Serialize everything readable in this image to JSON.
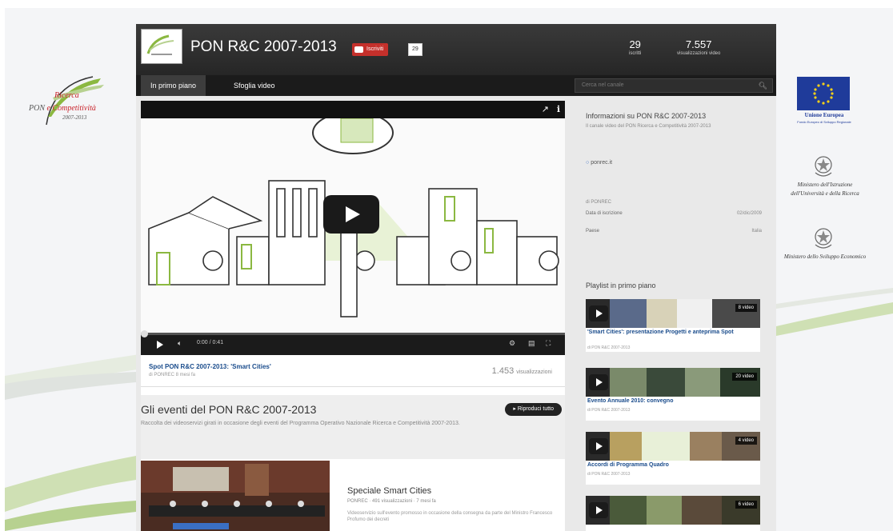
{
  "logo_left": {
    "line1": "Ricerca",
    "line2_prefix": "PON",
    "line2": "e Competitività",
    "line3": "2007-2013"
  },
  "logos_right": {
    "eu_title": "Unione Europea",
    "eu_subtitle": "Fondo Europeo di Sviluppo Regionale",
    "ministry1": "Ministero dell'Istruzione dell'Università e della Ricerca",
    "ministry2": "Ministero dello Sviluppo Economico"
  },
  "channel": {
    "title": "PON R&C 2007-2013",
    "subscribe_label": "Iscriviti",
    "subscribe_count": "29",
    "stats": [
      {
        "number": "29",
        "label": "iscritti"
      },
      {
        "number": "7.557",
        "label": "visualizzazioni video"
      }
    ]
  },
  "nav": {
    "tabs": [
      {
        "label": "In primo piano",
        "active": true
      },
      {
        "label": "Sfoglia video",
        "active": false
      }
    ],
    "search_placeholder": "Cerca nel canale"
  },
  "featured_video": {
    "time": "0:00 / 0:41",
    "title": "Spot PON R&C 2007-2013: 'Smart Cities'",
    "byline": "di PONREC 8 mesi fa",
    "views": "1.453",
    "views_label": "visualizzazioni"
  },
  "events": {
    "heading": "Gli eventi del PON R&C 2007-2013",
    "description": "Raccolta dei videoservizi girati in occasione degli eventi del Programma Operativo Nazionale Ricerca e Competitività 2007-2013.",
    "play_all": "Riproduci tutto"
  },
  "feature_item": {
    "title": "Speciale Smart Cities",
    "meta": "PONREC · 491 visualizzazioni · 7 mesi fa",
    "description": "Videoservizio sull'evento promosso in occasione della consegna da parte del Ministro Francesco Profumo dei decreti"
  },
  "about": {
    "heading": "Informazioni su PON R&C 2007-2013",
    "description": "Il canale video del PON Ricerca e Competitività 2007-2013",
    "link": "ponrec.it",
    "user": "di PONREC",
    "rows": [
      {
        "key": "Data di iscrizione",
        "value": "02/dic/2009"
      },
      {
        "key": "Paese",
        "value": "Italia"
      }
    ]
  },
  "playlists": {
    "heading": "Playlist in primo piano",
    "items": [
      {
        "title": "'Smart Cities': presentazione Progetti e anteprima Spot",
        "by": "di PON R&C 2007-2013",
        "count": "8 video"
      },
      {
        "title": "Evento Annuale 2010: convegno",
        "by": "di PON R&C 2007-2013",
        "count": "20 video"
      },
      {
        "title": "Accordi di Programma Quadro",
        "by": "di PON R&C 2007-2013",
        "count": "4 video"
      },
      {
        "title": "",
        "by": "",
        "count": "6 video"
      }
    ]
  }
}
